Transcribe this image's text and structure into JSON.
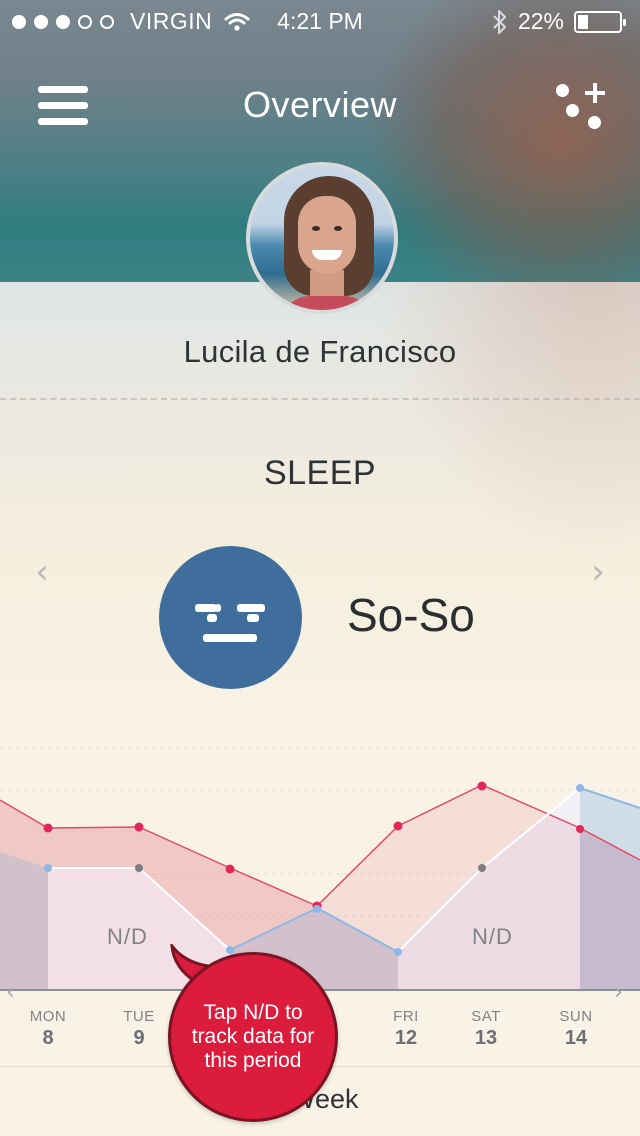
{
  "status_bar": {
    "carrier": "VIRGIN",
    "time": "4:21 PM",
    "battery": "22%",
    "battery_level": 0.22,
    "signal_bars_filled": 3,
    "signal_bars_total": 5
  },
  "nav": {
    "title": "Overview",
    "menu_icon": "hamburger-menu-icon",
    "add_icon": "add-dots-plus-icon"
  },
  "profile": {
    "name": "Lucila de Francisco"
  },
  "metric": {
    "section": "SLEEP",
    "mood_label": "So-So",
    "mood_color": "#3f6e9c",
    "prev_icon": "chevron-left-icon",
    "next_icon": "chevron-right-icon"
  },
  "week": {
    "days": [
      {
        "name": "MON",
        "date": "8"
      },
      {
        "name": "TUE",
        "date": "9"
      },
      {
        "name": "FRI",
        "date": "12"
      },
      {
        "name": "SAT",
        "date": "13"
      },
      {
        "name": "SUN",
        "date": "14"
      }
    ],
    "nd_label": "N/D",
    "label": "Week"
  },
  "tooltip": {
    "text": "Tap N/D to track data for this period",
    "color": "#dc1c3c"
  },
  "colors": {
    "red_series": "#e04d68",
    "blue_series": "#8fb7e6",
    "gray_point": "#7f7f7f"
  }
}
